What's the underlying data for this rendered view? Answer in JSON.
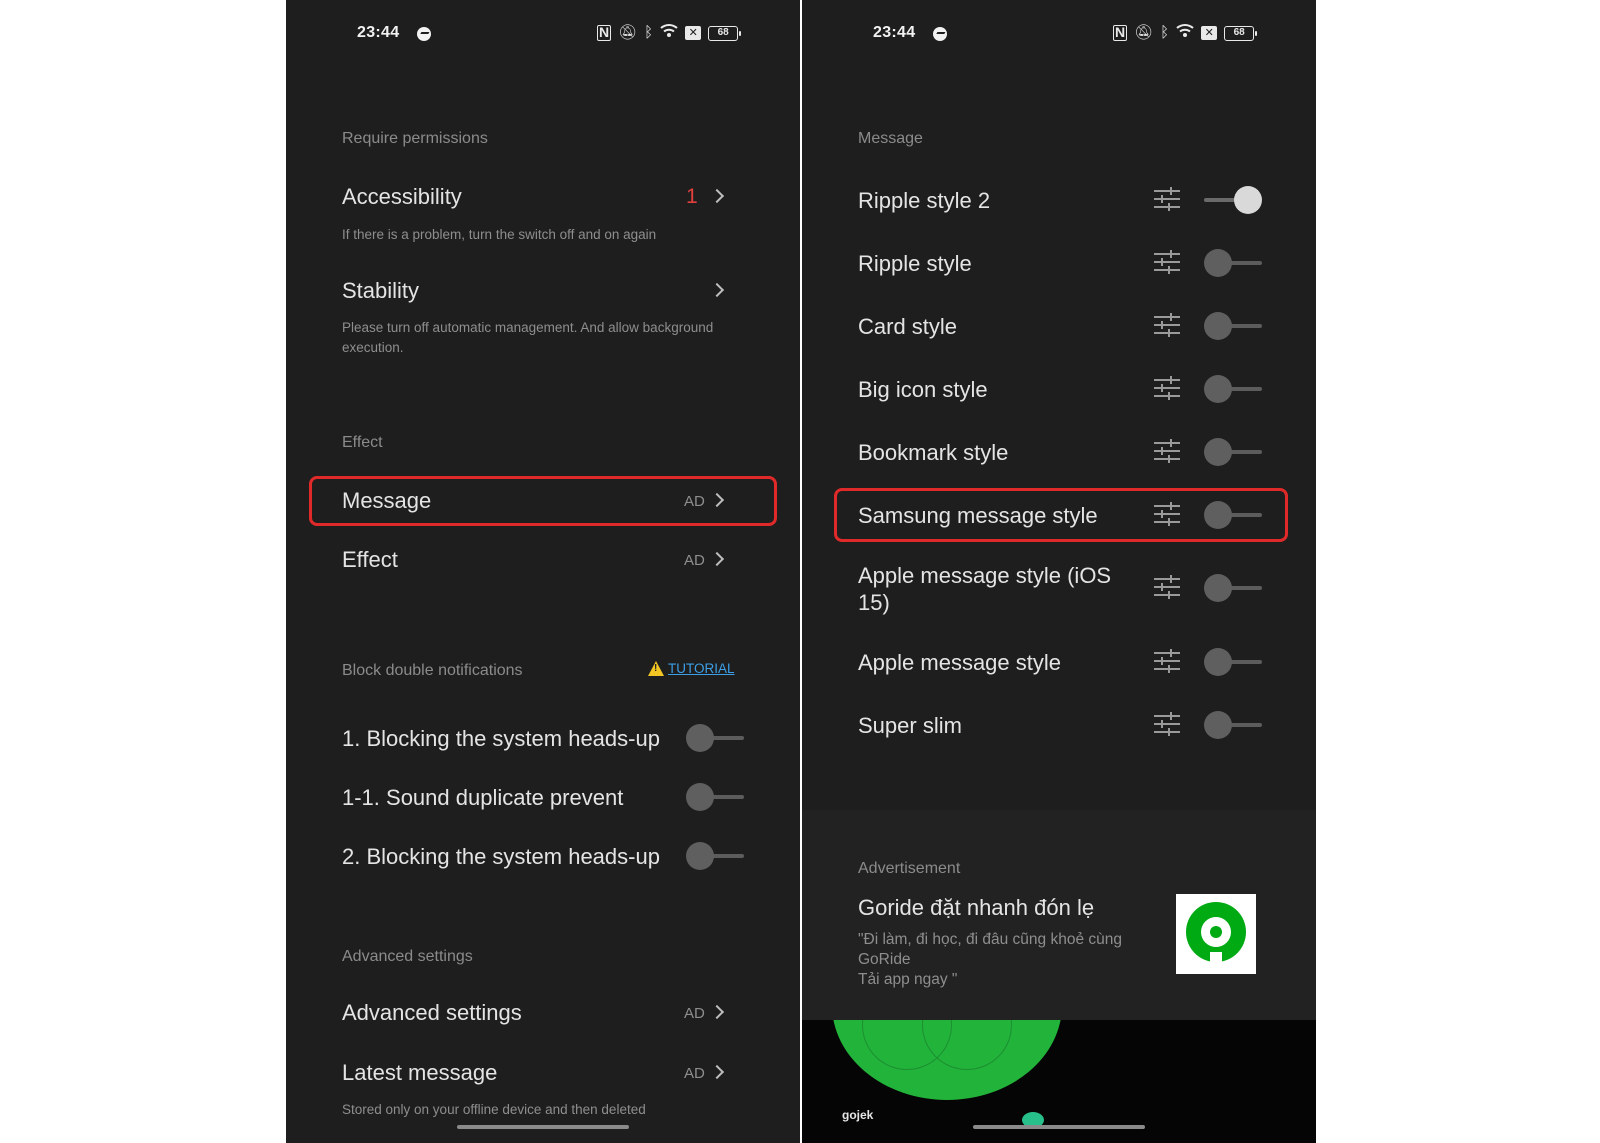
{
  "status_bar": {
    "time": "23:44",
    "battery": "68",
    "icons": [
      "messenger-icon",
      "nfc-icon",
      "mute-icon",
      "bluetooth-icon",
      "wifi-icon",
      "x-icon",
      "battery-icon"
    ]
  },
  "left": {
    "require_permissions": {
      "header": "Require permissions",
      "accessibility": {
        "title": "Accessibility",
        "badge": "1",
        "subtitle": "If there is a problem, turn the switch off and on again"
      },
      "stability": {
        "title": "Stability",
        "subtitle": "Please turn off automatic management. And allow background execution."
      }
    },
    "effect": {
      "header": "Effect",
      "message": {
        "title": "Message",
        "ad": "AD"
      },
      "effect": {
        "title": "Effect",
        "ad": "AD"
      }
    },
    "block": {
      "header": "Block double notifications",
      "tutorial": "TUTORIAL",
      "items": [
        {
          "label": "1. Blocking the system heads-up",
          "on": false
        },
        {
          "label": "1-1. Sound duplicate prevent",
          "on": false
        },
        {
          "label": "2. Blocking the system heads-up",
          "on": false
        }
      ]
    },
    "advanced": {
      "header": "Advanced settings",
      "advanced_settings": {
        "title": "Advanced settings",
        "ad": "AD"
      },
      "latest_message": {
        "title": "Latest message",
        "ad": "AD",
        "subtitle": "Stored only on your offline device and then deleted"
      }
    }
  },
  "right": {
    "header": "Message",
    "styles": [
      {
        "label": "Ripple style 2",
        "on": true
      },
      {
        "label": "Ripple style",
        "on": false
      },
      {
        "label": "Card style",
        "on": false
      },
      {
        "label": "Big icon style",
        "on": false
      },
      {
        "label": "Bookmark style",
        "on": false
      },
      {
        "label": "Samsung message style",
        "on": false
      },
      {
        "label": "Apple message style (iOS 15)",
        "on": false
      },
      {
        "label": "Apple message style",
        "on": false
      },
      {
        "label": "Super slim",
        "on": false
      }
    ],
    "advertisement": {
      "label": "Advertisement",
      "title": "Goride đặt nhanh đón lẹ",
      "description": "\"Đi làm, đi học, đi đâu cũng khoẻ cùng GoRide\nTải app ngay \"",
      "banner_text": "gojek"
    }
  },
  "colors": {
    "background": "#1e1e1e",
    "highlight": "#e02a2a",
    "badge": "#e2403c",
    "link": "#3b9ee6",
    "warning": "#f3c623",
    "brand_green": "#00aa13"
  }
}
